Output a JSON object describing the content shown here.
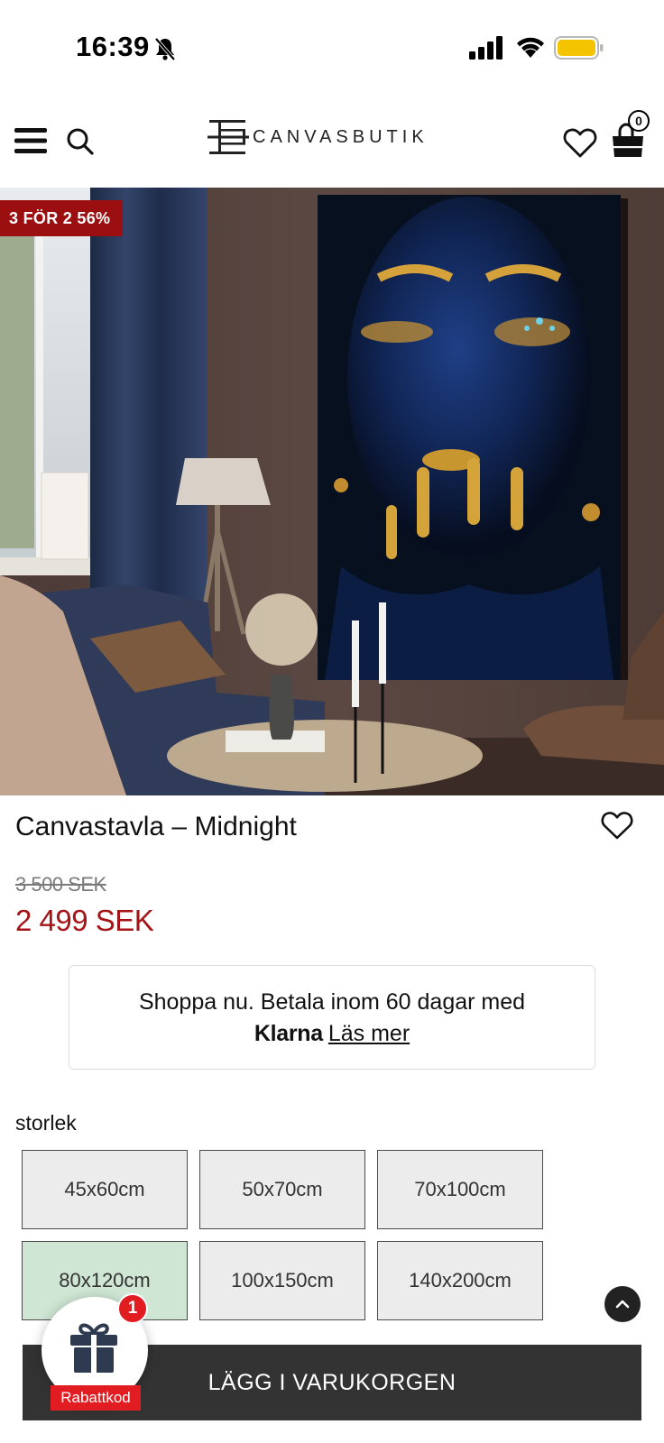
{
  "status_bar": {
    "time": "16:39",
    "battery_color": "#f5c400"
  },
  "header": {
    "logo_text": "CANVASBUTIK",
    "cart_count": "0"
  },
  "hero": {
    "promo_badge": "3 FÖR 2 56%"
  },
  "product": {
    "title": "Canvastavla – Midnight",
    "old_price": "3 500 SEK",
    "new_price": "2 499 SEK",
    "price_color": "#a51417"
  },
  "klarna": {
    "line1": "Shoppa nu. Betala inom 60 dagar med",
    "brand": "Klarna",
    "link": "Läs mer"
  },
  "sizes": {
    "label": "storlek",
    "options": [
      "45x60cm",
      "50x70cm",
      "70x100cm",
      "80x120cm",
      "100x150cm",
      "140x200cm"
    ],
    "selected": "80x120cm"
  },
  "cta": {
    "add_to_cart": "LÄGG I VARUKORGEN"
  },
  "discount_widget": {
    "count": "1",
    "label": "Rabattkod"
  },
  "icons": {
    "bell": "bell-slash-icon",
    "menu": "hamburger-menu-icon",
    "search": "search-icon",
    "wishlist": "heart-icon",
    "cart": "shopping-bag-icon",
    "gift": "gift-icon",
    "scroll_top": "chevron-up-icon"
  }
}
